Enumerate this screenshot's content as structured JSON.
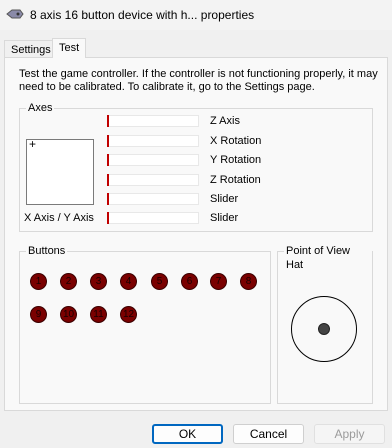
{
  "window": {
    "title": "8 axis 16 button device with h... properties",
    "icon": "game-controller-icon"
  },
  "tabs": [
    {
      "label": "Settings",
      "selected": false
    },
    {
      "label": "Test",
      "selected": true
    }
  ],
  "intro_text": "Test the game controller.  If the controller is not functioning properly, it may need to be calibrated.  To calibrate it, go to the Settings page.",
  "axes": {
    "group_label": "Axes",
    "xy_label": "X Axis / Y Axis",
    "bars": [
      {
        "label": "Z Axis",
        "level": 0
      },
      {
        "label": "X Rotation",
        "level": 0
      },
      {
        "label": "Y Rotation",
        "level": 0
      },
      {
        "label": "Z Rotation",
        "level": 0
      },
      {
        "label": "Slider",
        "level": 0
      },
      {
        "label": "Slider",
        "level": 0
      }
    ]
  },
  "buttons_group": {
    "group_label": "Buttons",
    "buttons": [
      "1",
      "2",
      "3",
      "4",
      "5",
      "6",
      "7",
      "8",
      "9",
      "10",
      "11",
      "12"
    ]
  },
  "pov": {
    "group_label": "Point of View Hat"
  },
  "dialog_buttons": {
    "ok": "OK",
    "cancel": "Cancel",
    "apply": "Apply"
  },
  "colors": {
    "button_indicator": "#7a0000",
    "axis_marker": "#c00000",
    "ok_border": "#0067c0"
  }
}
